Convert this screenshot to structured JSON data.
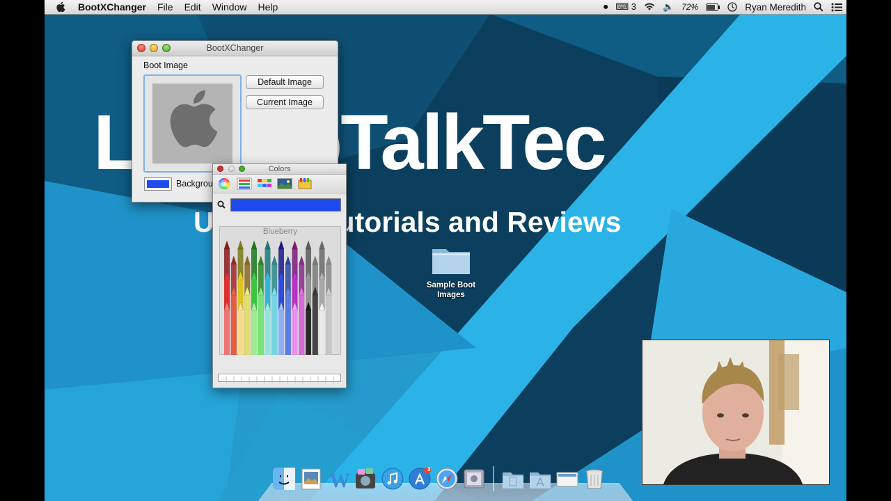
{
  "menubar": {
    "app_name": "BootXChanger",
    "menus": [
      "File",
      "Edit",
      "Window",
      "Help"
    ],
    "input_count": "3",
    "battery": "72%",
    "user": "Ryan Meredith"
  },
  "wallpaper": {
    "title": "LaptopTalkTec",
    "subtitle": "Updates, Tutorials and Reviews",
    "colors": {
      "light": "#2bb3e8",
      "dark": "#0b3f5d",
      "mid": "#0f5c85"
    }
  },
  "main_window": {
    "title": "BootXChanger",
    "boot_image_label": "Boot Image",
    "default_image_button": "Default Image",
    "current_image_button": "Current Image",
    "background_label": "Background",
    "background_color": "#1e4af0"
  },
  "colors_panel": {
    "title": "Colors",
    "selected_color_name": "Blueberry",
    "selected_color": "#1e4af0",
    "toolbar_icons": [
      "color-wheel-icon",
      "color-sliders-icon",
      "color-palettes-icon",
      "image-palettes-icon",
      "crayons-icon"
    ]
  },
  "desktop": {
    "folder_label_line1": "Sample Boot",
    "folder_label_line2": "Images"
  },
  "dock": {
    "apps": [
      "finder-icon",
      "preview-icon",
      "word-icon",
      "iphoto-icon",
      "itunes-icon",
      "app-store-icon",
      "safari-icon",
      "system-preferences-icon"
    ],
    "app_store_badge": "3",
    "stacks": [
      "documents-stack-icon",
      "applications-stack-icon",
      "downloads-stack-icon",
      "trash-icon"
    ]
  }
}
